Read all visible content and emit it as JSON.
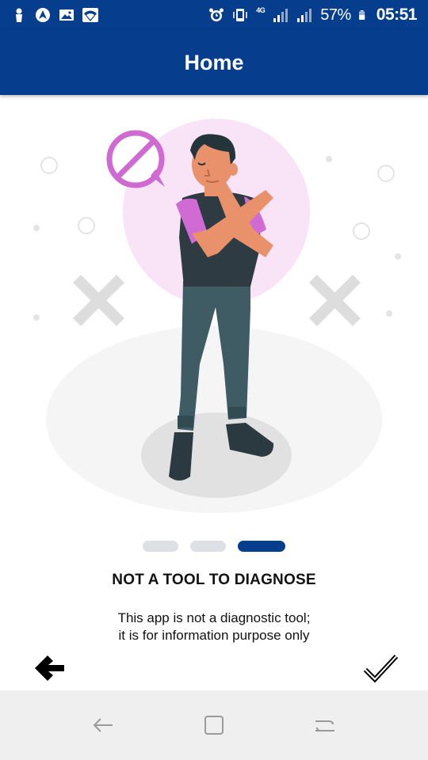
{
  "status_bar": {
    "battery": "57%",
    "time": "05:51",
    "network": "4G",
    "left_icons": [
      "person-icon",
      "nav-app-icon",
      "image-icon",
      "wifi-icon"
    ],
    "right_icons": [
      "alarm-icon",
      "vibrate-icon",
      "signal-icon",
      "signal-icon",
      "battery-icon"
    ]
  },
  "app_bar": {
    "title": "Home"
  },
  "slide": {
    "title": "NOT A TOOL TO DIAGNOSE",
    "body_line1": "This app is not a diagnostic tool;",
    "body_line2": "it is for information purpose only"
  },
  "indicator": {
    "count": 3,
    "active": 2
  },
  "nav": {
    "back_icon": "arrow-left-icon",
    "done_icon": "checkmark-icon"
  },
  "colors": {
    "primary": "#063d8c",
    "accent_pink": "#d16bd4",
    "skin": "#e8916b",
    "shirt": "#2f3b42",
    "pants": "#3f5b63",
    "indicator_inactive": "#dde1e6"
  }
}
